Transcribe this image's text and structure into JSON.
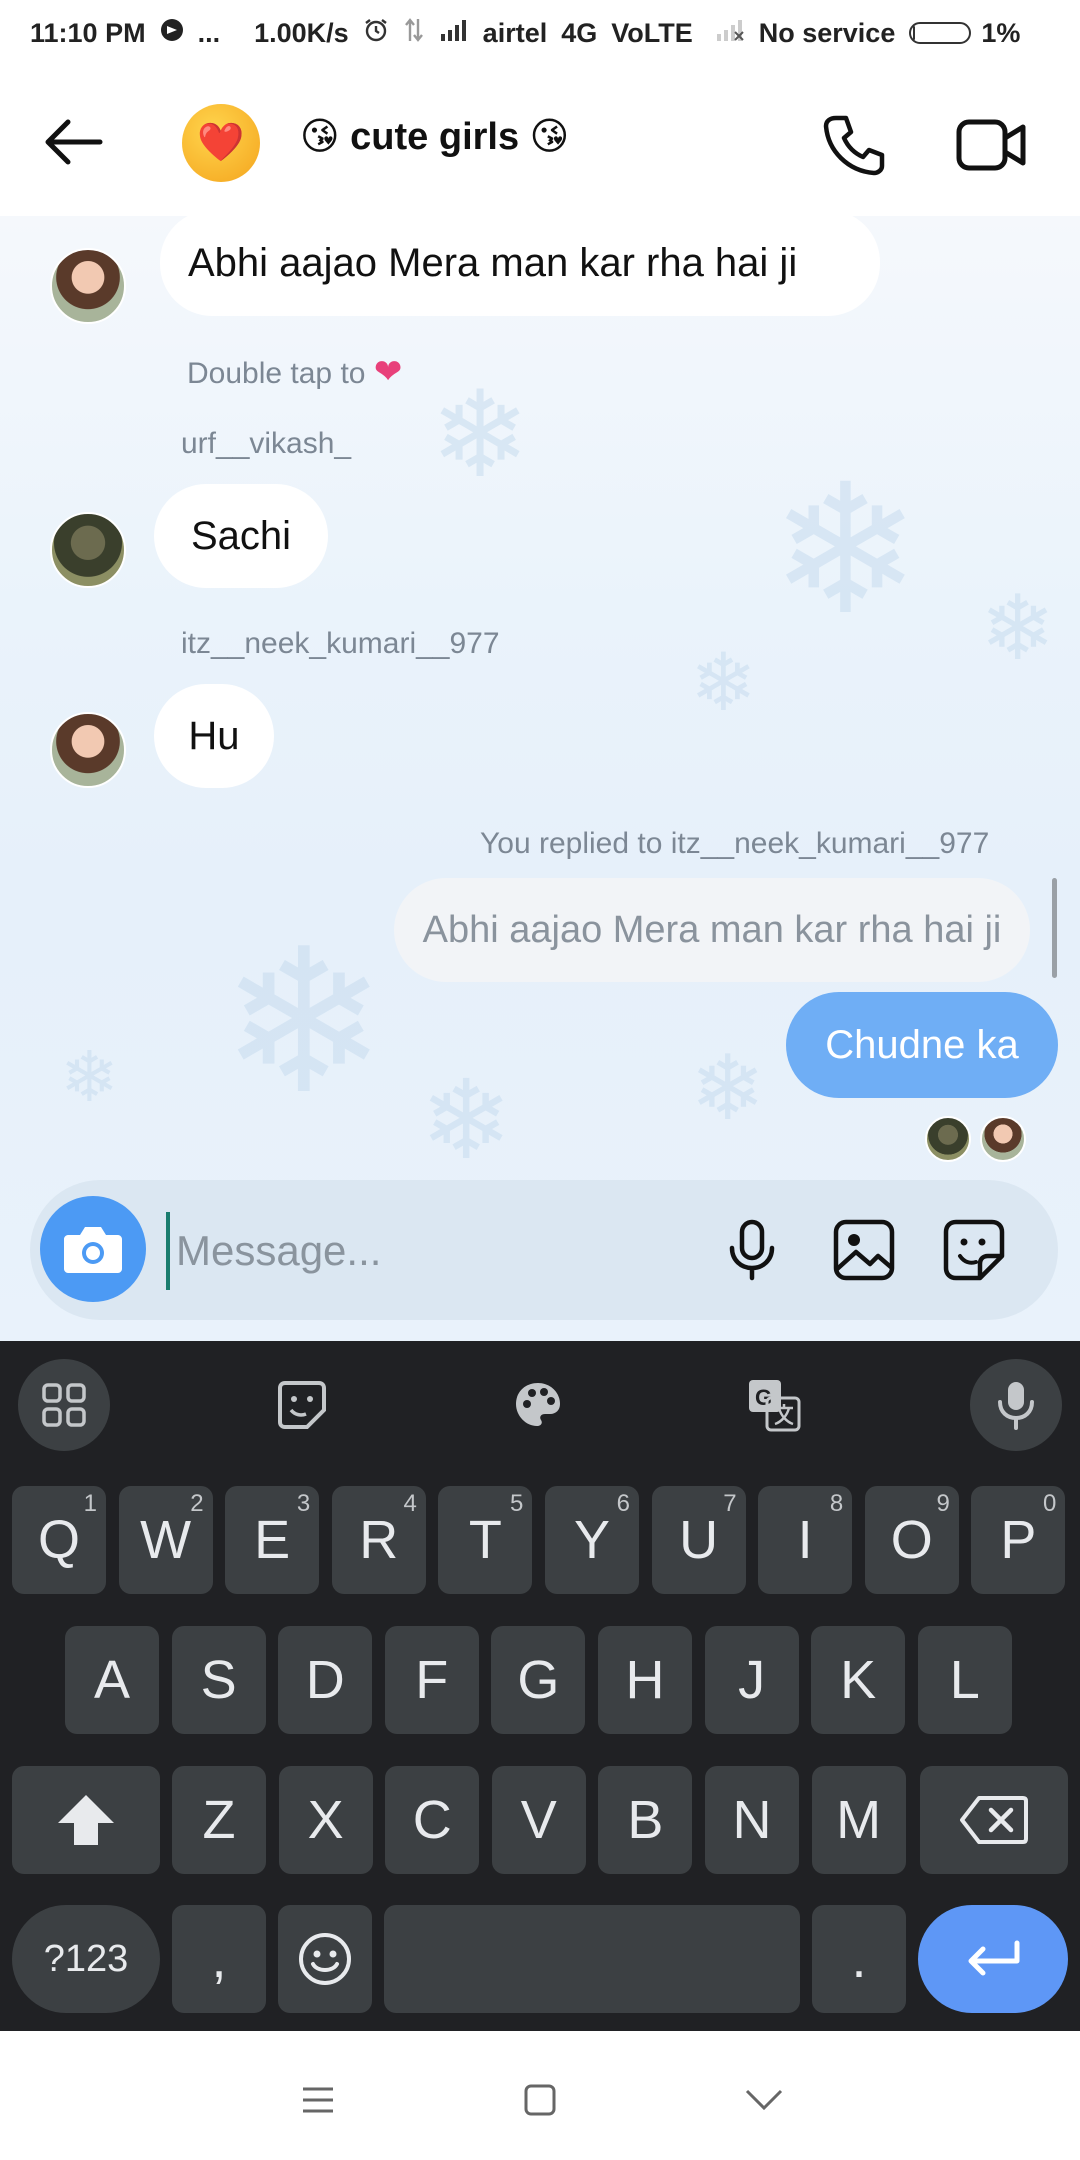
{
  "status_bar": {
    "time": "11:10 PM",
    "more": "...",
    "speed": "1.00K/s",
    "carrier": "airtel",
    "network": "4G",
    "volte": "VoLTE",
    "sim2": "No service",
    "battery": "1%"
  },
  "header": {
    "title": "😘 cute girls 😘",
    "avatar_emoji": "❤️"
  },
  "messages": {
    "m1_text": "Abhi aajao Mera man kar rha hai ji",
    "m1_hint_prefix": "Double tap to",
    "m1_hint_heart": "❤",
    "sender2": "urf__vikash_",
    "m2_text": "Sachi",
    "sender3": "itz__neek_kumari__977",
    "m3_text": "Hu",
    "reply_label": "You replied to itz__neek_kumari__977",
    "reply_quote": "Abhi aajao Mera man kar rha hai ji",
    "m4_text": "Chudne ka"
  },
  "composer": {
    "placeholder": "Message..."
  },
  "keyboard": {
    "row1": [
      {
        "k": "Q",
        "h": "1"
      },
      {
        "k": "W",
        "h": "2"
      },
      {
        "k": "E",
        "h": "3"
      },
      {
        "k": "R",
        "h": "4"
      },
      {
        "k": "T",
        "h": "5"
      },
      {
        "k": "Y",
        "h": "6"
      },
      {
        "k": "U",
        "h": "7"
      },
      {
        "k": "I",
        "h": "8"
      },
      {
        "k": "O",
        "h": "9"
      },
      {
        "k": "P",
        "h": "0"
      }
    ],
    "row2": [
      "A",
      "S",
      "D",
      "F",
      "G",
      "H",
      "J",
      "K",
      "L"
    ],
    "row3": [
      "Z",
      "X",
      "C",
      "V",
      "B",
      "N",
      "M"
    ],
    "symbols": "?123",
    "comma": ",",
    "period": "."
  },
  "colors": {
    "accent_blue": "#4c9af4",
    "outgoing_bubble": "#6faef5",
    "enter_key": "#5e97f6",
    "keyboard_bg": "#202124",
    "key_bg": "#3c4043"
  }
}
